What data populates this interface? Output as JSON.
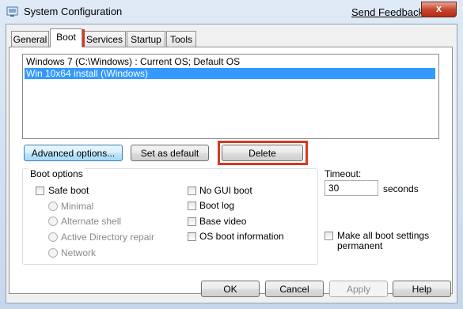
{
  "window": {
    "title": "System Configuration",
    "send_feedback": "Send Feedback",
    "close_glyph": "x"
  },
  "tabs": [
    {
      "label": "General"
    },
    {
      "label": "Boot"
    },
    {
      "label": "Services"
    },
    {
      "label": "Startup"
    },
    {
      "label": "Tools"
    }
  ],
  "active_tab": "Boot",
  "boot_entries": [
    {
      "label": "Windows 7 (C:\\Windows) : Current OS; Default OS",
      "selected": false
    },
    {
      "label": "Win 10x64 install (\\Windows)",
      "selected": true
    }
  ],
  "buttons": {
    "advanced": "Advanced options...",
    "set_default": "Set as default",
    "delete": "Delete"
  },
  "boot_options": {
    "group_label": "Boot options",
    "safe_boot": "Safe boot",
    "minimal": "Minimal",
    "alternate_shell": "Alternate shell",
    "active_directory_repair": "Active Directory repair",
    "network": "Network",
    "no_gui_boot": "No GUI boot",
    "boot_log": "Boot log",
    "base_video": "Base video",
    "os_boot_information": "OS boot information"
  },
  "timeout": {
    "label": "Timeout:",
    "value": "30",
    "unit": "seconds"
  },
  "make_permanent": {
    "line1": "Make all boot settings",
    "line2": "permanent"
  },
  "footer": {
    "ok": "OK",
    "cancel": "Cancel",
    "apply": "Apply",
    "help": "Help"
  },
  "colors": {
    "highlight": "#d43a1e",
    "selection": "#3399ff"
  }
}
